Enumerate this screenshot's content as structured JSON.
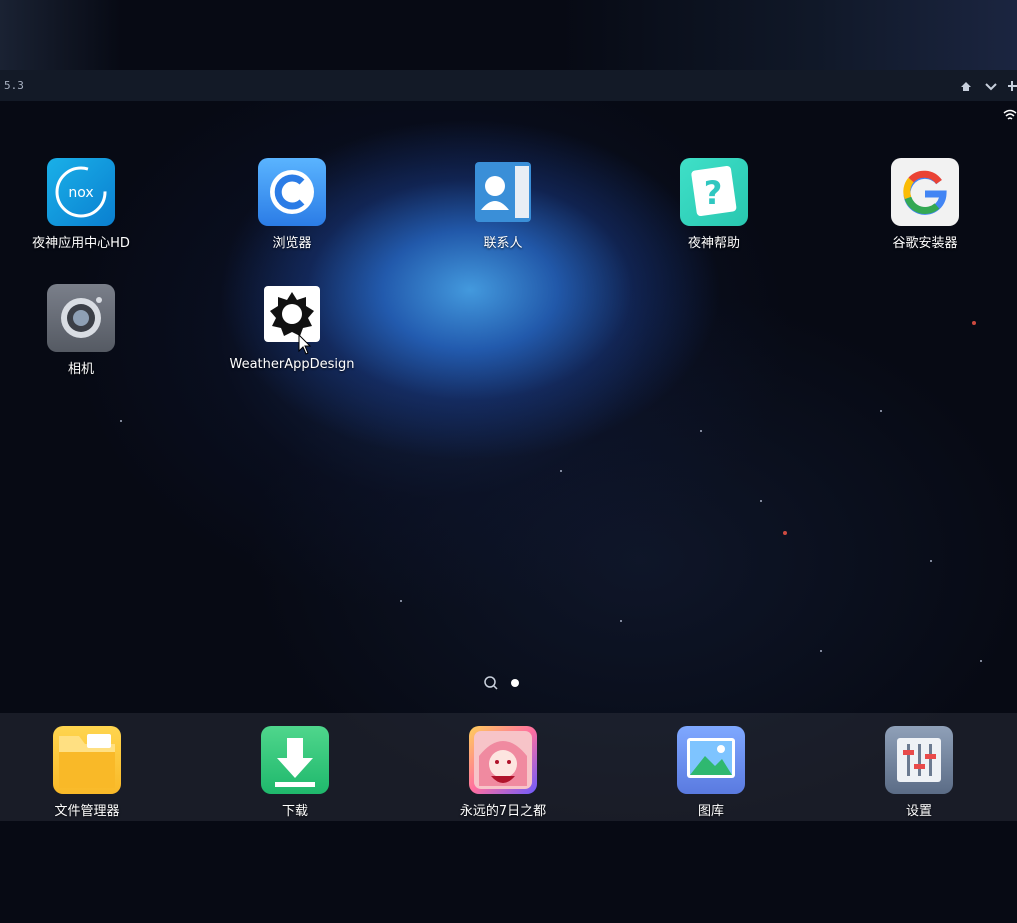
{
  "titlebar": {
    "version": "5.3"
  },
  "home_apps": [
    {
      "name": "app-nox-center",
      "label": "夜神应用中心HD",
      "icon": "nox-icon"
    },
    {
      "name": "app-browser",
      "label": "浏览器",
      "icon": "browser-icon"
    },
    {
      "name": "app-contacts",
      "label": "联系人",
      "icon": "contacts-icon"
    },
    {
      "name": "app-nox-help",
      "label": "夜神帮助",
      "icon": "help-icon"
    },
    {
      "name": "app-google-installer",
      "label": "谷歌安装器",
      "icon": "google-icon"
    },
    {
      "name": "app-camera",
      "label": "相机",
      "icon": "camera-icon"
    },
    {
      "name": "app-weather",
      "label": "WeatherAppDesign",
      "icon": "weather-gear-icon"
    }
  ],
  "dock_apps": [
    {
      "name": "dock-file-manager",
      "label": "文件管理器",
      "icon": "folder-icon"
    },
    {
      "name": "dock-download",
      "label": "下载",
      "icon": "download-icon"
    },
    {
      "name": "dock-game",
      "label": "永远的7日之都",
      "icon": "game-icon"
    },
    {
      "name": "dock-gallery",
      "label": "图库",
      "icon": "gallery-icon"
    },
    {
      "name": "dock-settings",
      "label": "设置",
      "icon": "settings-icon"
    }
  ],
  "page_indicator": {
    "pages": 1,
    "current": 1
  }
}
